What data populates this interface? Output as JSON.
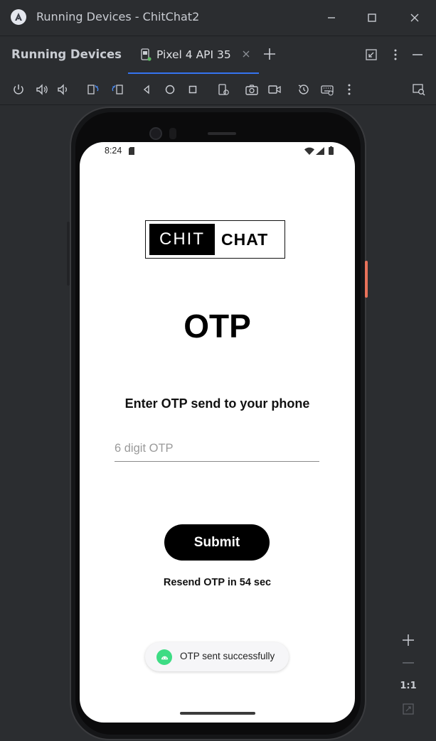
{
  "window": {
    "title": "Running Devices - ChitChat2"
  },
  "tool_window": {
    "title": "Running Devices",
    "tabs": [
      {
        "label": "Pixel 4 API 35",
        "icon": "device-icon",
        "active": true
      }
    ]
  },
  "toolbar": {
    "buttons": [
      "power-icon",
      "volume-up-icon",
      "volume-down-icon",
      "rotate-left-icon",
      "rotate-right-icon",
      "back-icon",
      "home-icon",
      "overview-icon",
      "fold-icon",
      "screenshot-icon",
      "screen-record-icon",
      "snapshot-icon",
      "keyboard-icon",
      "more-icon",
      "device-inspect-icon"
    ]
  },
  "device": {
    "status_bar": {
      "time": "8:24"
    },
    "app": {
      "logo_left": "CHIT",
      "logo_right": "CHAT",
      "title": "OTP",
      "subtitle": "Enter OTP send to your phone",
      "otp_placeholder": "6 digit OTP",
      "otp_value": "",
      "submit_label": "Submit",
      "resend_text": "Resend OTP in 54 sec"
    },
    "toast": {
      "text": "OTP sent successfully"
    }
  },
  "zoom_panel": {
    "actual_size_label": "1:1"
  },
  "colors": {
    "ide_background": "#2b2d30",
    "active_tab_underline": "#3574f0",
    "android_green": "#3ddc84",
    "side_button": "#e8725a"
  }
}
